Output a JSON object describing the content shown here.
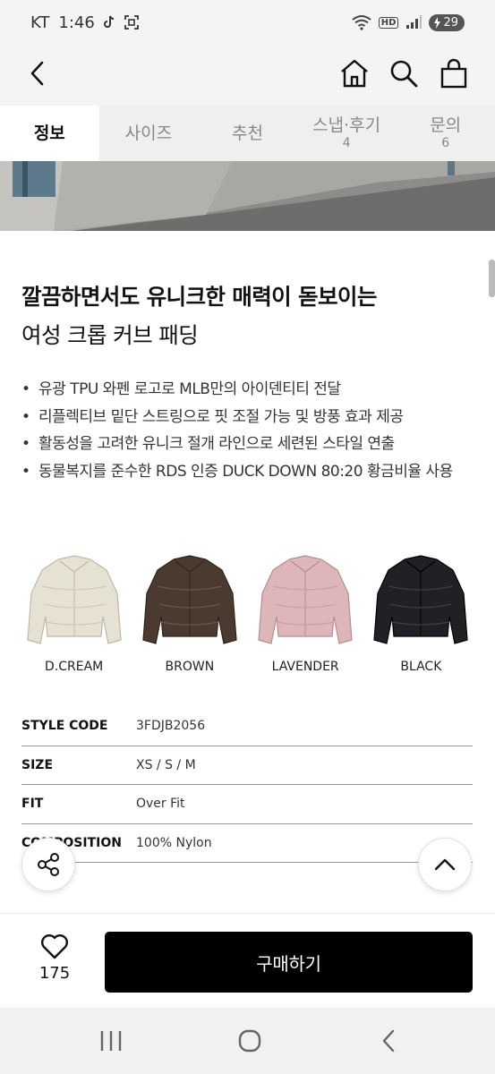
{
  "status_bar": {
    "carrier": "KT",
    "time": "1:46",
    "hd_label": "HD",
    "battery": "29"
  },
  "header": {
    "back_icon": "chevron-left-icon",
    "home_icon": "home-icon",
    "search_icon": "search-icon",
    "bag_icon": "shopping-bag-icon"
  },
  "tabs": [
    {
      "label": "정보",
      "count": ""
    },
    {
      "label": "사이즈",
      "count": ""
    },
    {
      "label": "추천",
      "count": ""
    },
    {
      "label": "스냅·후기",
      "count": "4"
    },
    {
      "label": "문의",
      "count": "6"
    }
  ],
  "product": {
    "headline": "깔끔하면서도 유니크한 매력이 돋보이는",
    "subhead": "여성 크롭 커브 패딩",
    "features": [
      "유광 TPU 와펜 로고로 MLB만의 아이덴티티 전달",
      "리플렉티브 밑단 스트링으로 핏 조절 가능 및 방풍 효과 제공",
      "활동성을 고려한 유니크 절개 라인으로 세련된 스타일 연출",
      "동물복지를 준수한 RDS 인증 DUCK DOWN 80:20 황금비율 사용"
    ],
    "colors": [
      {
        "name": "D.CREAM",
        "hex": "#e6e2d3"
      },
      {
        "name": "BROWN",
        "hex": "#4a3a30"
      },
      {
        "name": "LAVENDER",
        "hex": "#dcb6b8"
      },
      {
        "name": "BLACK",
        "hex": "#1f2125"
      }
    ],
    "specs": [
      {
        "key": "STYLE CODE",
        "value": "3FDJB2056"
      },
      {
        "key": "SIZE",
        "value": "XS / S / M"
      },
      {
        "key": "FIT",
        "value": "Over Fit"
      },
      {
        "key": "COMPOSITION",
        "value": "100% Nylon"
      }
    ]
  },
  "actions": {
    "share_icon": "share-icon",
    "top_icon": "chevron-up-icon",
    "like_icon": "heart-icon",
    "like_count": "175",
    "buy_label": "구매하기"
  },
  "system_nav": {
    "recents_icon": "recents-icon",
    "home_icon": "home-circle-icon",
    "back_icon": "back-icon"
  }
}
